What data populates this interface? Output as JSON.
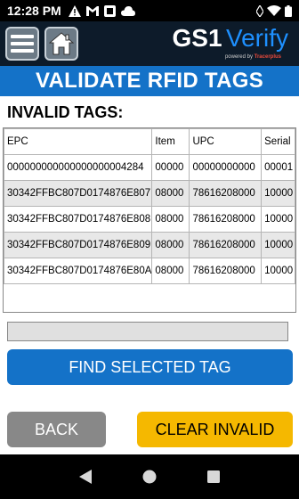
{
  "status_bar": {
    "time": "12:28 PM",
    "icons_left": [
      "warning-icon",
      "gmail-icon",
      "outlook-icon",
      "cloud-icon"
    ],
    "icons_right": [
      "alarm-icon",
      "wifi-icon",
      "battery-icon"
    ]
  },
  "header": {
    "brand_primary": "GS1",
    "brand_secondary": "Verify",
    "powered_prefix": "powered by",
    "powered_brand": "Tracerplus"
  },
  "title": "VALIDATE RFID TAGS",
  "section_label": "INVALID TAGS:",
  "table": {
    "columns": [
      "EPC",
      "Item",
      "UPC",
      "Serial"
    ],
    "rows": [
      [
        "000000000000000000004284",
        "00000",
        "00000000000",
        "00001"
      ],
      [
        "30342FFBC807D0174876E807",
        "08000",
        "78616208000",
        "10000"
      ],
      [
        "30342FFBC807D0174876E808",
        "08000",
        "78616208000",
        "10000"
      ],
      [
        "30342FFBC807D0174876E809",
        "08000",
        "78616208000",
        "10000"
      ],
      [
        "30342FFBC807D0174876E80A",
        "08000",
        "78616208000",
        "10000"
      ]
    ]
  },
  "progress": {
    "value": 0
  },
  "buttons": {
    "find": "FIND SELECTED TAG",
    "back": "BACK",
    "clear": "CLEAR INVALID"
  },
  "colors": {
    "header_bg": "#0d1b2a",
    "accent_blue": "#1472c8",
    "clear_yellow": "#f5b800",
    "back_gray": "#888888"
  }
}
